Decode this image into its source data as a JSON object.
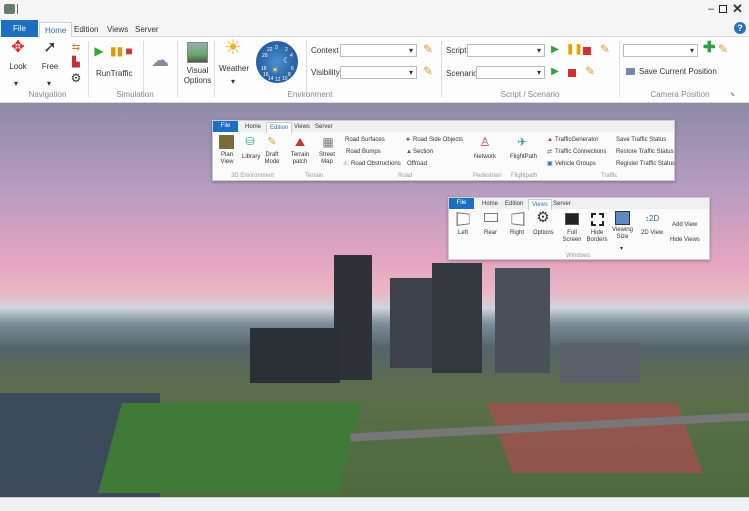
{
  "titlebar": {
    "app_icon": "app-icon",
    "controls": [
      "minimize-icon",
      "maximize-icon",
      "close-icon"
    ],
    "help_icon": "help-icon"
  },
  "tabs": {
    "file": "File",
    "items": [
      "Home",
      "Edition",
      "Views",
      "Server"
    ],
    "active": "Home"
  },
  "ribbon": {
    "navigation": {
      "label": "Navigation",
      "look": "Look",
      "free": "Free"
    },
    "simulation": {
      "label": "Simulation",
      "run_traffic": "RunTraffic"
    },
    "environment": {
      "label": "Environment",
      "visual_options": "Visual Options",
      "weather": "Weather",
      "context_label": "Context",
      "context_value": "",
      "visibility_label": "Visibility",
      "visibility_value": "",
      "clock_numbers": [
        "22",
        "0",
        "2",
        "20",
        "4",
        "18",
        "6",
        "16",
        "8",
        "14",
        "12",
        "10"
      ]
    },
    "script": {
      "label": "Script / Scenario",
      "script_label": "Script",
      "script_value": "",
      "scenario_label": "Scenario",
      "scenario_value": ""
    },
    "camera": {
      "label": "Camera Position",
      "position_value": "",
      "save": "Save Current Position"
    }
  },
  "edition_panel": {
    "file": "File",
    "tabs": [
      "Home",
      "Edition",
      "Views",
      "Server"
    ],
    "active": "Edition",
    "items": {
      "plan_view": "Plan View",
      "library": "Library",
      "draft_mode": "Draft Mode",
      "terrain_patch": "Terrain patch",
      "street_map": "Street Map",
      "road_surfaces": "Road Surfaces",
      "road_bumps": "Road Bumps",
      "road_obstructions": "Road Obstructions",
      "road_side_objects": "Road Side Objects",
      "section": "Section",
      "offroad": "Offroad",
      "network": "Network",
      "flightpath": "FlightPath",
      "traffic_generator": "TrafficGenerator",
      "traffic_connections": "Traffic Connections",
      "vehicle_groups": "Vehicle Groups",
      "save_traffic": "Save Traffic Status",
      "restore_traffic": "Restore Traffic Status",
      "register_traffic": "Register Traffic Status"
    },
    "groups": {
      "env": "3D Environment",
      "terrain": "Terrain",
      "road": "Road",
      "pedestrian": "Pedestrian",
      "flightpath": "Flightpath",
      "traffic": "Traffic"
    }
  },
  "views_panel": {
    "file": "File",
    "tabs": [
      "Home",
      "Edition",
      "Views",
      "Server"
    ],
    "active": "Views",
    "items": {
      "left": "Left",
      "rear": "Rear",
      "right": "Right",
      "options": "Options",
      "full_screen": "Full Screen",
      "hide_borders": "Hide Borders",
      "viewing_size": "Viewing Size",
      "view_2d": "2D View",
      "add_view": "Add View",
      "hide_views": "Hide Views"
    },
    "group": "Windows"
  },
  "colors": {
    "accent": "#1e6fc0",
    "play": "#2ea043",
    "stop": "#d32f2f",
    "pause": "#e8a200"
  }
}
